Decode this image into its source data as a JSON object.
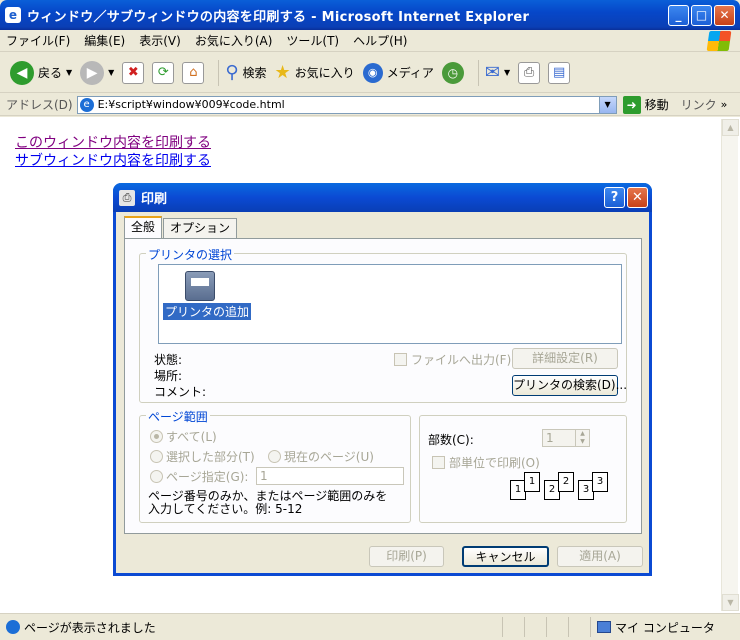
{
  "window": {
    "title": "ウィンドウ／サブウィンドウの内容を印刷する - Microsoft Internet Explorer",
    "minimize": "_",
    "maximize": "□",
    "close": "✕"
  },
  "menu": [
    "ファイル(F)",
    "編集(E)",
    "表示(V)",
    "お気に入り(A)",
    "ツール(T)",
    "ヘルプ(H)"
  ],
  "toolbar": {
    "back_label": "戻る",
    "search_label": "検索",
    "favorites_label": "お気に入り",
    "media_label": "メディア"
  },
  "address": {
    "label": "アドレス(D)",
    "url": "E:¥script¥window¥009¥code.html",
    "go_label": "移動",
    "links_label": "リンク",
    "links_more": "»"
  },
  "page": {
    "link1": "このウィンドウ内容を印刷する",
    "link2": "サブウィンドウ内容を印刷する"
  },
  "status": {
    "text": "ページが表示されました",
    "zone": "マイ コンピュータ"
  },
  "dialog": {
    "title": "印刷",
    "help": "?",
    "close": "✕",
    "tabs": [
      "全般",
      "オプション"
    ],
    "printer_group": "プリンタの選択",
    "printer_item": "プリンタの追加",
    "status_label": "状態:",
    "location_label": "場所:",
    "comment_label": "コメント:",
    "print_to_file": "ファイルへ出力(F)",
    "preferences_button": "詳細設定(R)",
    "find_printer_button": "プリンタの検索(D)...",
    "range_group": "ページ範囲",
    "range_all": "すべて(L)",
    "range_selection": "選択した部分(T)",
    "range_current": "現在のページ(U)",
    "range_pages": "ページ指定(G):",
    "pages_value": "1",
    "range_note": "ページ番号のみか、またはページ範囲のみを入力してください。例: 5-12",
    "copies_label": "部数(C):",
    "copies_value": "1",
    "collate_label": "部単位で印刷(O)",
    "collate_pages": [
      "1",
      "1",
      "2",
      "2",
      "3",
      "3"
    ],
    "print_button": "印刷(P)",
    "cancel_button": "キャンセル",
    "apply_button": "適用(A)"
  }
}
